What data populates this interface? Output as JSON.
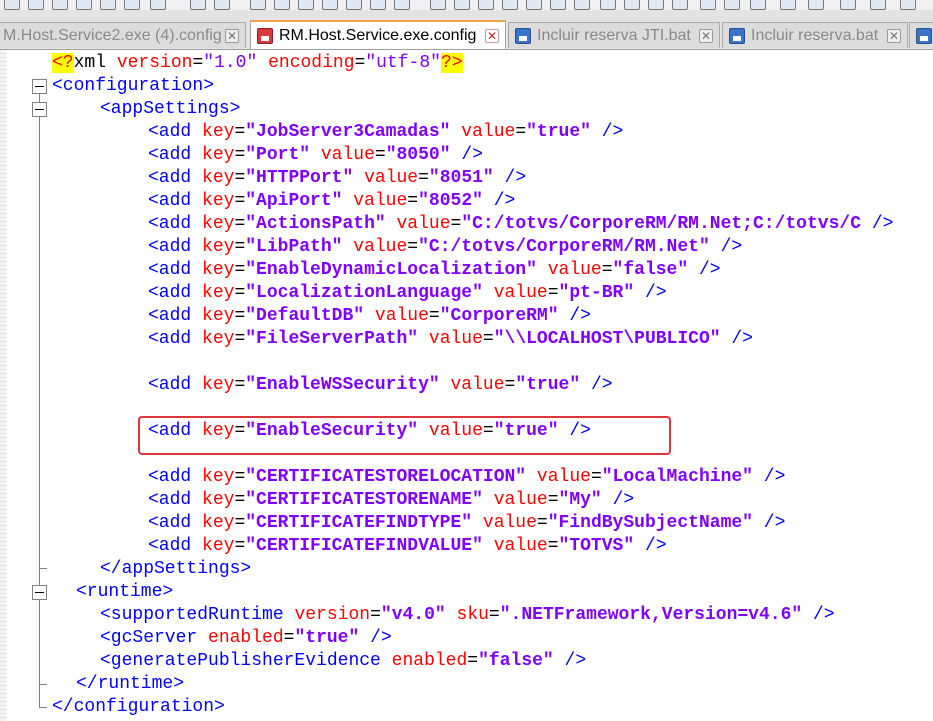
{
  "tabs": [
    {
      "label": "M.Host.Service2.exe (4).config",
      "active": false,
      "icon": "save-icon-blue"
    },
    {
      "label": "RM.Host.Service.exe.config",
      "active": true,
      "icon": "save-icon-red"
    },
    {
      "label": "Incluir reserva JTI.bat",
      "active": false,
      "icon": "save-icon-blue"
    },
    {
      "label": "Incluir reserva.bat",
      "active": false,
      "icon": "save-icon-blue"
    }
  ],
  "close_glyph": "✕",
  "code": {
    "decl": {
      "open": "<?",
      "name": "xml",
      "a1": "version",
      "v1": "\"1.0\"",
      "a2": "encoding",
      "v2": "\"utf-8\"",
      "close": "?>"
    },
    "configuration_open": "<configuration>",
    "appsettings_open": "<appSettings>",
    "add_entries": [
      {
        "key": "\"JobServer3Camadas\"",
        "value": "\"true\""
      },
      {
        "key": "\"Port\"",
        "value": "\"8050\""
      },
      {
        "key": "\"HTTPPort\"",
        "value": "\"8051\""
      },
      {
        "key": "\"ApiPort\"",
        "value": "\"8052\""
      },
      {
        "key": "\"ActionsPath\"",
        "value": "\"C:/totvs/CorporeRM/RM.Net;C:/totvs/C"
      },
      {
        "key": "\"LibPath\"",
        "value": "\"C:/totvs/CorporeRM/RM.Net\""
      },
      {
        "key": "\"EnableDynamicLocalization\"",
        "value": "\"false\""
      },
      {
        "key": "\"LocalizationLanguage\"",
        "value": "\"pt-BR\""
      },
      {
        "key": "\"DefaultDB\"",
        "value": "\"CorporeRM\""
      },
      {
        "key": "\"FileServerPath\"",
        "value": "\"\\\\LOCALHOST\\PUBLICO\""
      },
      {
        "key": "\"EnableWSSecurity\"",
        "value": "\"true\""
      },
      {
        "key": "\"EnableSecurity\"",
        "value": "\"true\""
      },
      {
        "key": "\"CERTIFICATESTORELOCATION\"",
        "value": "\"LocalMachine\""
      },
      {
        "key": "\"CERTIFICATESTORENAME\"",
        "value": "\"My\""
      },
      {
        "key": "\"CERTIFICATEFINDTYPE\"",
        "value": "\"FindBySubjectName\""
      },
      {
        "key": "\"CERTIFICATEFINDVALUE\"",
        "value": "\"TOTVS\""
      }
    ],
    "add_tag": "<add",
    "key_attr": "key",
    "value_attr": "value",
    "self_close": "/>",
    "appsettings_close": "</appSettings>",
    "runtime_open": "<runtime>",
    "supported_runtime": {
      "tag": "<supportedRuntime",
      "a1": "version",
      "v1": "\"v4.0\"",
      "a2": "sku",
      "v2": "\".NETFramework,Version=v4.6\"",
      "close": "/>"
    },
    "gc_server": {
      "tag": "<gcServer",
      "a1": "enabled",
      "v1": "\"true\"",
      "close": "/>"
    },
    "gen_publisher": {
      "tag": "<generatePublisherEvidence",
      "a1": "enabled",
      "v1": "\"false\"",
      "close": "/>"
    },
    "runtime_close": "</runtime>",
    "configuration_close": "</configuration>"
  },
  "colors": {
    "tag": "#0000ff",
    "attr": "#ff0000",
    "value": "#8000ff",
    "highlight_box": "#d9363e",
    "active_tab_accent": "#f0a14b"
  }
}
